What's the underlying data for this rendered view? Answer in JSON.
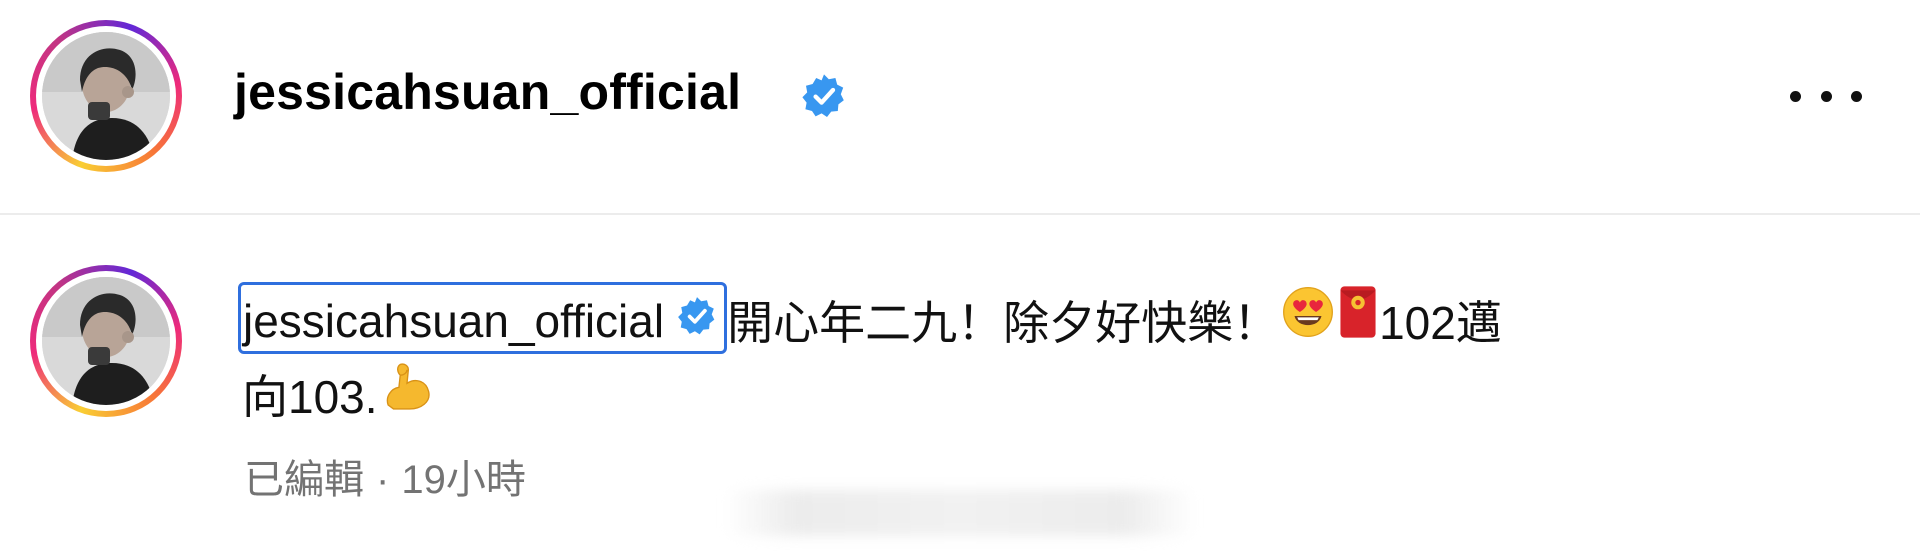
{
  "header": {
    "username": "jessicahsuan_official",
    "verified_icon": "verified-badge-icon",
    "more_icon": "more-options-icon"
  },
  "caption": {
    "author": "jessicahsuan_official",
    "line1_text": "開心年二九！除夕好快樂！",
    "line1_tail": "102邁",
    "line2_text": "向103.",
    "emojis": [
      "smiling-face-with-heart-eyes-icon",
      "red-envelope-icon",
      "flexed-biceps-icon"
    ]
  },
  "meta": {
    "edited": "已編輯",
    "separator": "·",
    "time": "19小時"
  },
  "colors": {
    "text": "#000000",
    "meta": "#737373",
    "verified": "#3897f0",
    "focus_outline": "#2f6fde",
    "divider": "#ececec"
  }
}
